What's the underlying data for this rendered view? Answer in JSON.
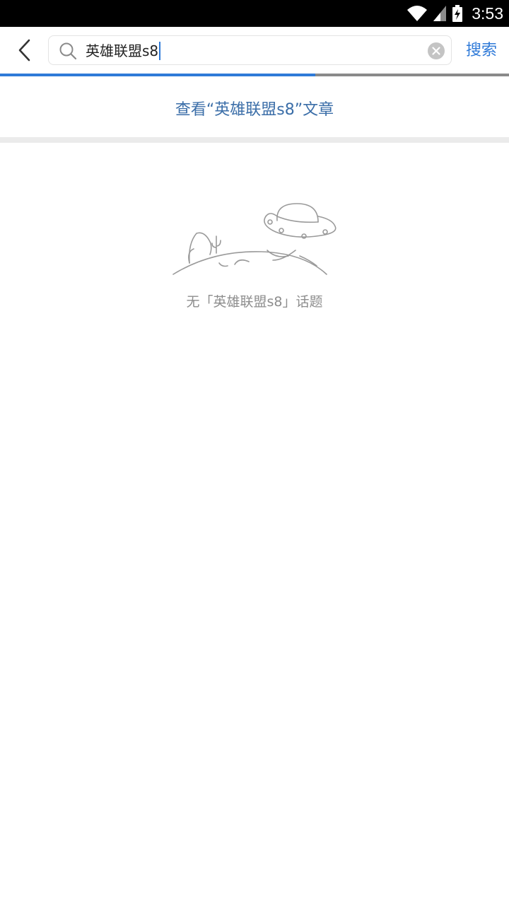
{
  "status_bar": {
    "time": "3:53",
    "icons": [
      "wifi-icon",
      "cellular-signal-icon",
      "battery-charging-icon"
    ]
  },
  "toolbar": {
    "back_icon": "chevron-left-icon",
    "search_icon": "search-icon",
    "search_value": "英雄联盟s8",
    "clear_icon": "clear-circle-icon",
    "search_button_label": "搜索"
  },
  "progress": {
    "value": 0.62,
    "color": "#2f7ad8"
  },
  "view_articles_label": "查看“英雄联盟s8”文章",
  "empty_state": {
    "illustration": "ufo-planet-illustration",
    "message": "无「英雄联盟s8」话题"
  },
  "colors": {
    "accent": "#2f7ad8",
    "link": "#3b6ea8",
    "muted_text": "#8d8d8d",
    "divider": "#ebebeb"
  }
}
